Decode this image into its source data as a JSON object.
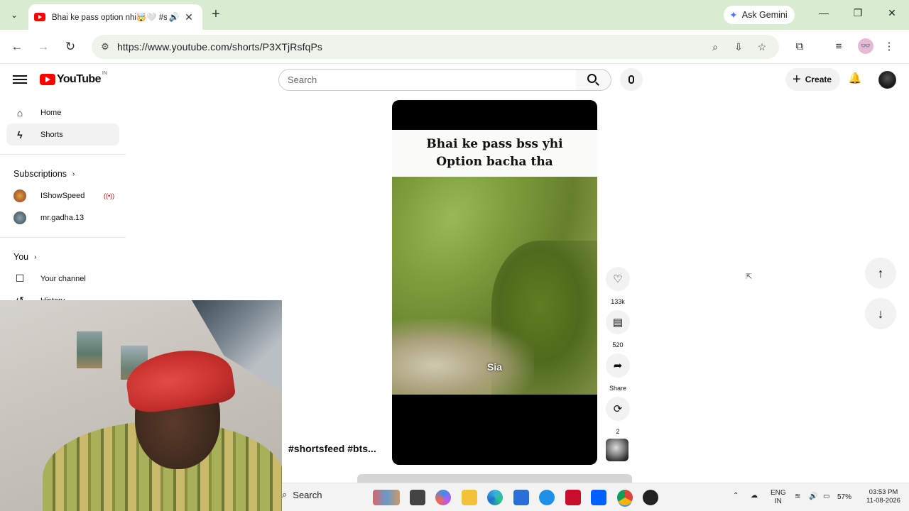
{
  "browser": {
    "tab_title": "Bhai ke pass option nhi🤯🤍 #sh",
    "ask_gemini": "Ask Gemini",
    "url": "https://www.youtube.com/shorts/P3XTjRsfqPs"
  },
  "youtube": {
    "logo_text": "YouTube",
    "country_code": "IN",
    "search_placeholder": "Search",
    "create_label": "Create"
  },
  "sidebar": {
    "home": "Home",
    "shorts": "Shorts",
    "subscriptions": "Subscriptions",
    "channels": [
      {
        "name": "IShowSpeed",
        "live": "((•))"
      },
      {
        "name": "mr.gadha.13"
      }
    ],
    "you": "You",
    "your_channel": "Your channel",
    "history": "History"
  },
  "short": {
    "caption_line1": "Bhai ke pass bss yhi",
    "caption_line2": "Option bacha tha",
    "overlay_text": "Sia",
    "hashtags": "#shortsfeed #bts...",
    "likes": "133k",
    "comments": "520",
    "share": "Share",
    "remix": "2"
  },
  "taskbar": {
    "search": "Search",
    "lang_line1": "ENG",
    "lang_line2": "IN",
    "battery": "57%",
    "time": "03:53 PM",
    "date": "11-08-2026"
  },
  "colors": {
    "chrome_tabbar": "#d9ecd2",
    "youtube_red": "#ff0000",
    "live_red": "#cc0000"
  }
}
